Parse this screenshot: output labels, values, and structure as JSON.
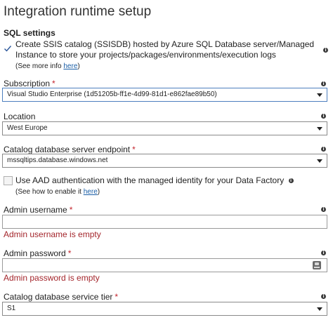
{
  "page": {
    "title": "Integration runtime setup"
  },
  "sql": {
    "heading": "SQL settings",
    "create_catalog_text": "Create SSIS catalog (SSISDB) hosted by Azure SQL Database server/Managed Instance to store your projects/packages/environments/execution logs",
    "see_more_prefix": "(See more info ",
    "see_more_link": "here",
    "see_more_suffix": ")",
    "create_catalog_checked": true
  },
  "subscription": {
    "label": "Subscription",
    "required_mark": "*",
    "value": "Visual Studio Enterprise (1d51205b-ff1e-4d99-81d1-e862fae89b50)"
  },
  "location": {
    "label": "Location",
    "value": "West Europe"
  },
  "endpoint": {
    "label": "Catalog database server endpoint",
    "required_mark": "*",
    "value": "mssqltips.database.windows.net"
  },
  "aad": {
    "text": "Use AAD authentication with the managed identity for your Data Factory",
    "how_prefix": "(See how to enable it ",
    "how_link": "here",
    "how_suffix": ")",
    "checked": false
  },
  "admin_username": {
    "label": "Admin username",
    "required_mark": "*",
    "value": "",
    "error": "Admin username is empty"
  },
  "admin_password": {
    "label": "Admin password",
    "required_mark": "*",
    "value": "",
    "error": "Admin password is empty"
  },
  "tier": {
    "label": "Catalog database service tier",
    "required_mark": "*",
    "value": "S1"
  },
  "icons": {
    "info": "info-icon",
    "dropdown": "chevron-down-icon",
    "checkmark": "checkmark-icon",
    "key": "key-icon"
  },
  "colors": {
    "error": "#a4262c",
    "required": "#c4262e",
    "link": "#1a5ea6",
    "focus_border": "#4d7fbf"
  }
}
